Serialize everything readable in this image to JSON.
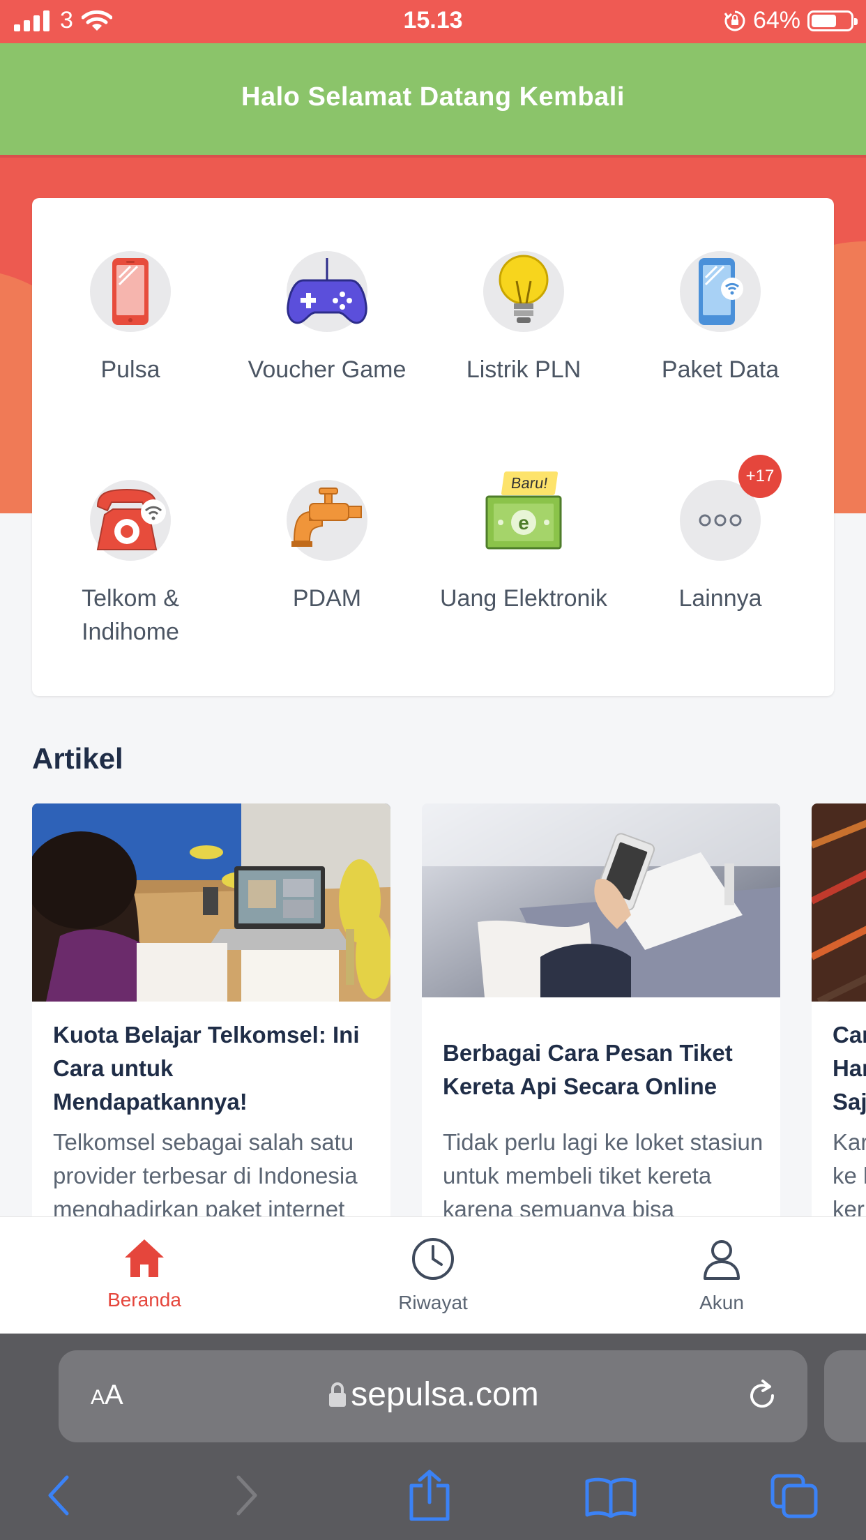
{
  "status_bar": {
    "carrier": "3",
    "time": "15.13",
    "battery": "64%",
    "battery_level": 0.64
  },
  "header": {
    "title": "Halo Selamat Datang Kembali"
  },
  "services": [
    {
      "label": "Pulsa",
      "icon": "phone-icon"
    },
    {
      "label": "Voucher Game",
      "icon": "gamepad-icon"
    },
    {
      "label": "Listrik PLN",
      "icon": "lightbulb-icon"
    },
    {
      "label": "Paket Data",
      "icon": "phone-wifi-icon"
    },
    {
      "label": "Telkom & Indihome",
      "icon": "telephone-icon"
    },
    {
      "label": "PDAM",
      "icon": "water-tap-icon"
    },
    {
      "label": "Uang Elektronik",
      "icon": "e-money-icon",
      "badge": "Baru!"
    },
    {
      "label": "Lainnya",
      "icon": "more-icon",
      "count": "+17"
    }
  ],
  "articles_section": {
    "title": "Artikel",
    "items": [
      {
        "title": "Kuota Belajar Telkomsel: Ini Cara untuk Mendapatkannya!",
        "excerpt": "Telkomsel sebagai salah satu provider terbesar di Indonesia menghadirkan paket internet"
      },
      {
        "title": "Berbagai Cara Pesan Tiket Kereta Api Secara Online",
        "excerpt": "Tidak perlu lagi ke loket stasiun untuk membeli tiket kereta karena semuanya bisa"
      },
      {
        "title": "Car Har Saj",
        "excerpt": "Kar ke l ker"
      }
    ]
  },
  "bottom_nav": [
    {
      "label": "Beranda",
      "icon": "home-icon",
      "active": true
    },
    {
      "label": "Riwayat",
      "icon": "clock-icon",
      "active": false
    },
    {
      "label": "Akun",
      "icon": "user-icon",
      "active": false
    }
  ],
  "browser": {
    "text_size_label_small": "A",
    "text_size_label_large": "A",
    "url": "sepulsa.com"
  },
  "colors": {
    "status_red": "#ef5a53",
    "header_green": "#8bc46a",
    "accent_red": "#e5463c",
    "title_navy": "#1f2d47",
    "ios_blue": "#3b82f6"
  }
}
